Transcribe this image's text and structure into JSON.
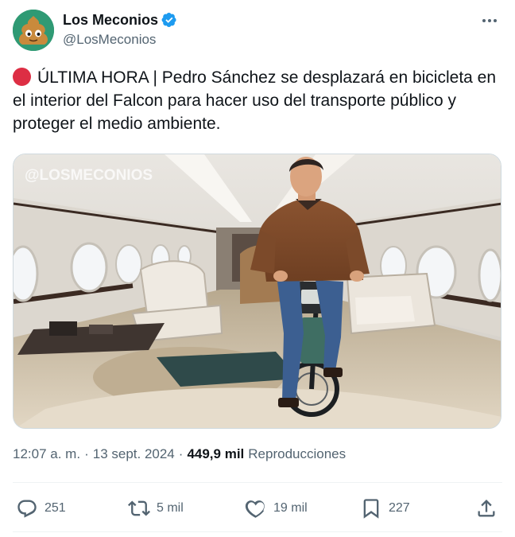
{
  "author": {
    "display_name": "Los Meconios",
    "handle": "@LosMeconios"
  },
  "tweet": {
    "text": "ÚLTIMA HORA | Pedro Sánchez se desplazará en bicicleta en el interior del Falcon para hacer uso del transporte público y proteger el medio ambiente.",
    "watermark": "@LOSMECONIOS"
  },
  "meta": {
    "time": "12:07 a. m.",
    "date": "13 sept. 2024",
    "separator": "·",
    "views_count": "449,9 mil",
    "views_label": "Reproducciones"
  },
  "actions": {
    "replies": "251",
    "reposts": "5 mil",
    "likes": "19 mil",
    "bookmarks": "227"
  },
  "colors": {
    "verified": "#1d9bf0",
    "alert_dot": "#dd2e44",
    "muted_text": "#536471"
  },
  "icons": [
    "verified-badge-icon",
    "more-options-icon",
    "red-circle-icon",
    "reply-icon",
    "repost-icon",
    "like-icon",
    "bookmark-icon",
    "share-icon"
  ]
}
